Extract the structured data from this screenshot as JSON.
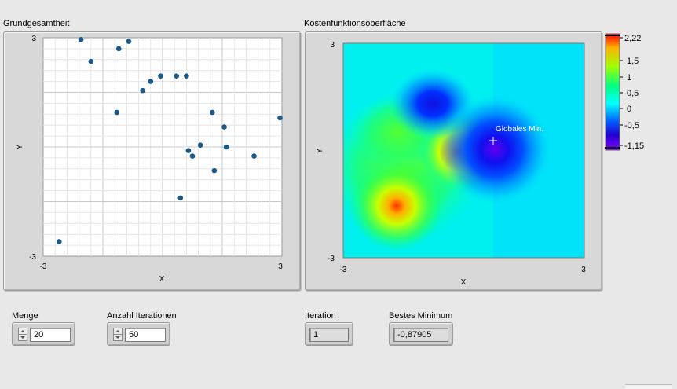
{
  "population_chart": {
    "title": "Grundgesamtheit",
    "xlabel": "X",
    "ylabel": "Y",
    "x_ticks": [
      "-3",
      "3"
    ],
    "y_ticks": [
      "3",
      "-3"
    ]
  },
  "surface_chart": {
    "title": "Kostenfunktionsoberfläche",
    "xlabel": "X",
    "ylabel": "Y",
    "x_ticks": [
      "-3",
      "3"
    ],
    "y_ticks": [
      "3",
      "-3"
    ],
    "annotation": "Globales Min.",
    "colorbar": {
      "labels": [
        "2,22",
        "1,5",
        "1",
        "0,5",
        "0",
        "-0,5",
        "-1,15"
      ],
      "colors": [
        "#ff0000",
        "#ffd000",
        "#90ff00",
        "#00ff90",
        "#00ffff",
        "#0050ff",
        "#2000c0",
        "#8000ff"
      ]
    }
  },
  "controls": {
    "menge": {
      "label": "Menge",
      "value": "20"
    },
    "iterations": {
      "label": "Anzahl Iterationen",
      "value": "50"
    },
    "iteration": {
      "label": "Iteration",
      "value": "1"
    },
    "best_min": {
      "label": "Bestes Minimum",
      "value": "-0,87905"
    }
  },
  "chart_data": [
    {
      "type": "scatter",
      "title": "Grundgesamtheit",
      "xlabel": "X",
      "ylabel": "Y",
      "xlim": [
        -3,
        3
      ],
      "ylim": [
        -3,
        3
      ],
      "grid": true,
      "color": "#1a5a8a",
      "x": [
        -2.05,
        -1.8,
        -1.1,
        -0.85,
        -1.15,
        -0.5,
        -0.3,
        -0.05,
        0.35,
        0.6,
        1.25,
        1.55,
        0.65,
        0.75,
        0.95,
        1.6,
        1.3,
        2.3,
        2.95,
        0.45,
        -2.6
      ],
      "y": [
        2.95,
        2.35,
        2.7,
        2.9,
        0.95,
        1.55,
        1.8,
        1.95,
        1.95,
        1.95,
        0.95,
        0.55,
        -0.1,
        -0.25,
        0.05,
        0.0,
        -0.65,
        -0.25,
        0.8,
        -1.4,
        -2.6
      ]
    },
    {
      "type": "heatmap",
      "title": "Kostenfunktionsoberfläche",
      "xlabel": "X",
      "ylabel": "Y",
      "xlim": [
        -3,
        3
      ],
      "ylim": [
        -3,
        3
      ],
      "zlim": [
        -1.15,
        2.22
      ],
      "features": [
        {
          "kind": "peak",
          "x": -1.65,
          "y": -1.1,
          "z": 1.95
        },
        {
          "kind": "peak",
          "x": -0.1,
          "y": 0.3,
          "z": 2.1
        },
        {
          "kind": "valley",
          "x": 0.0,
          "y": 1.05,
          "z": -0.7
        },
        {
          "kind": "global-min",
          "x": 0.85,
          "y": 0.35,
          "z": -1.15
        }
      ]
    }
  ]
}
